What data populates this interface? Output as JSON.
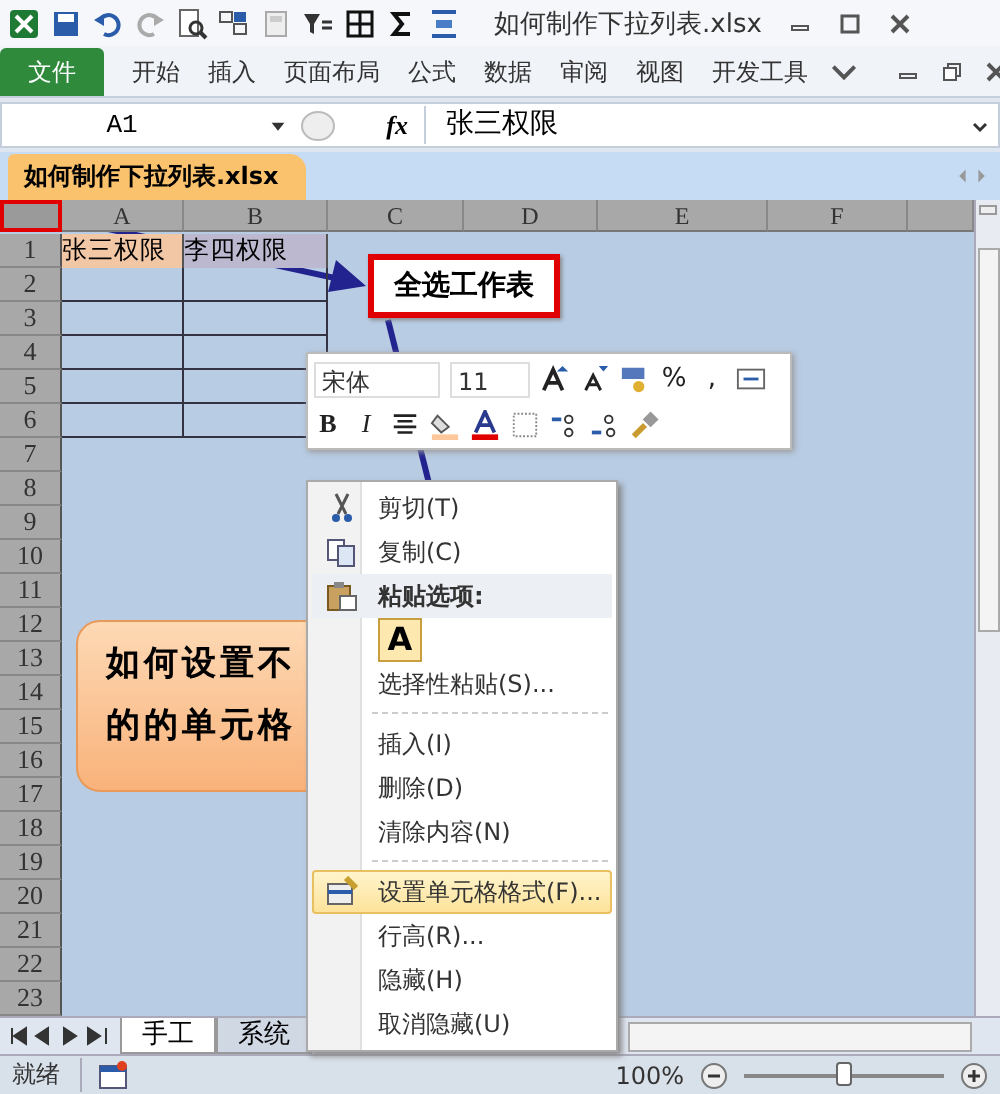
{
  "window": {
    "title": "如何制作下拉列表.xlsx"
  },
  "quick_access": [
    {
      "kind": "save"
    },
    {
      "kind": "undo"
    },
    {
      "kind": "redo"
    },
    {
      "kind": "preview"
    },
    {
      "kind": "layout"
    },
    {
      "kind": "calc"
    },
    {
      "kind": "filter"
    },
    {
      "kind": "borders"
    },
    {
      "kind": "sum"
    },
    {
      "kind": "align"
    }
  ],
  "ribbon_tabs": [
    {
      "label": "文件",
      "kind": "file"
    },
    {
      "label": "开始",
      "kind": "tab"
    },
    {
      "label": "插入",
      "kind": "tab"
    },
    {
      "label": "页面布局",
      "kind": "tab"
    },
    {
      "label": "公式",
      "kind": "tab"
    },
    {
      "label": "数据",
      "kind": "tab"
    },
    {
      "label": "审阅",
      "kind": "tab"
    },
    {
      "label": "视图",
      "kind": "tab"
    },
    {
      "label": "开发工具",
      "kind": "tab"
    }
  ],
  "formula_bar": {
    "name_box": "A1",
    "fx": "fx",
    "value": "张三权限"
  },
  "workbook_tab": "如何制作下拉列表.xlsx",
  "columns": [
    "A",
    "B",
    "C",
    "D",
    "E",
    "F"
  ],
  "rows": [
    "1",
    "2",
    "3",
    "4",
    "5",
    "6",
    "7",
    "8",
    "9",
    "10",
    "11",
    "12",
    "13",
    "14",
    "15",
    "16",
    "17",
    "18",
    "19",
    "20",
    "21",
    "22",
    "23"
  ],
  "row1_cells": [
    {
      "text": "张三权限",
      "kind": "active"
    },
    {
      "text": "李四权限",
      "kind": "plain"
    }
  ],
  "annotation": {
    "text": "全选工作表"
  },
  "mini_toolbar": {
    "font": "宋体",
    "size": "11",
    "percent": "%",
    "comma": ",",
    "bold": "B",
    "italic": "I"
  },
  "context_menu": [
    {
      "kind": "item",
      "label": "剪切(T)",
      "selected": false
    },
    {
      "kind": "item",
      "label": "复制(C)",
      "selected": false
    },
    {
      "kind": "header",
      "label": "粘贴选项:"
    },
    {
      "kind": "paste",
      "label": "A"
    },
    {
      "kind": "item",
      "label": "选择性粘贴(S)...",
      "selected": false
    },
    {
      "kind": "separator"
    },
    {
      "kind": "item",
      "label": "插入(I)",
      "selected": false
    },
    {
      "kind": "item",
      "label": "删除(D)",
      "selected": false
    },
    {
      "kind": "item",
      "label": "清除内容(N)",
      "selected": false
    },
    {
      "kind": "separator"
    },
    {
      "kind": "item",
      "label": "设置单元格格式(F)...",
      "selected": true
    },
    {
      "kind": "item",
      "label": "行高(R)...",
      "selected": false
    },
    {
      "kind": "item",
      "label": "隐藏(H)",
      "selected": false
    },
    {
      "kind": "item",
      "label": "取消隐藏(U)",
      "selected": false
    }
  ],
  "callout": {
    "lines": [
      "如何设置不",
      "的的单元格"
    ]
  },
  "sheet_tabs": [
    {
      "label": "手工",
      "selected": true
    },
    {
      "label": "系统",
      "selected": false
    }
  ],
  "status_bar": {
    "text": "就绪",
    "zoom": "100%",
    "zoom_slider": {
      "level": 0.5
    }
  }
}
